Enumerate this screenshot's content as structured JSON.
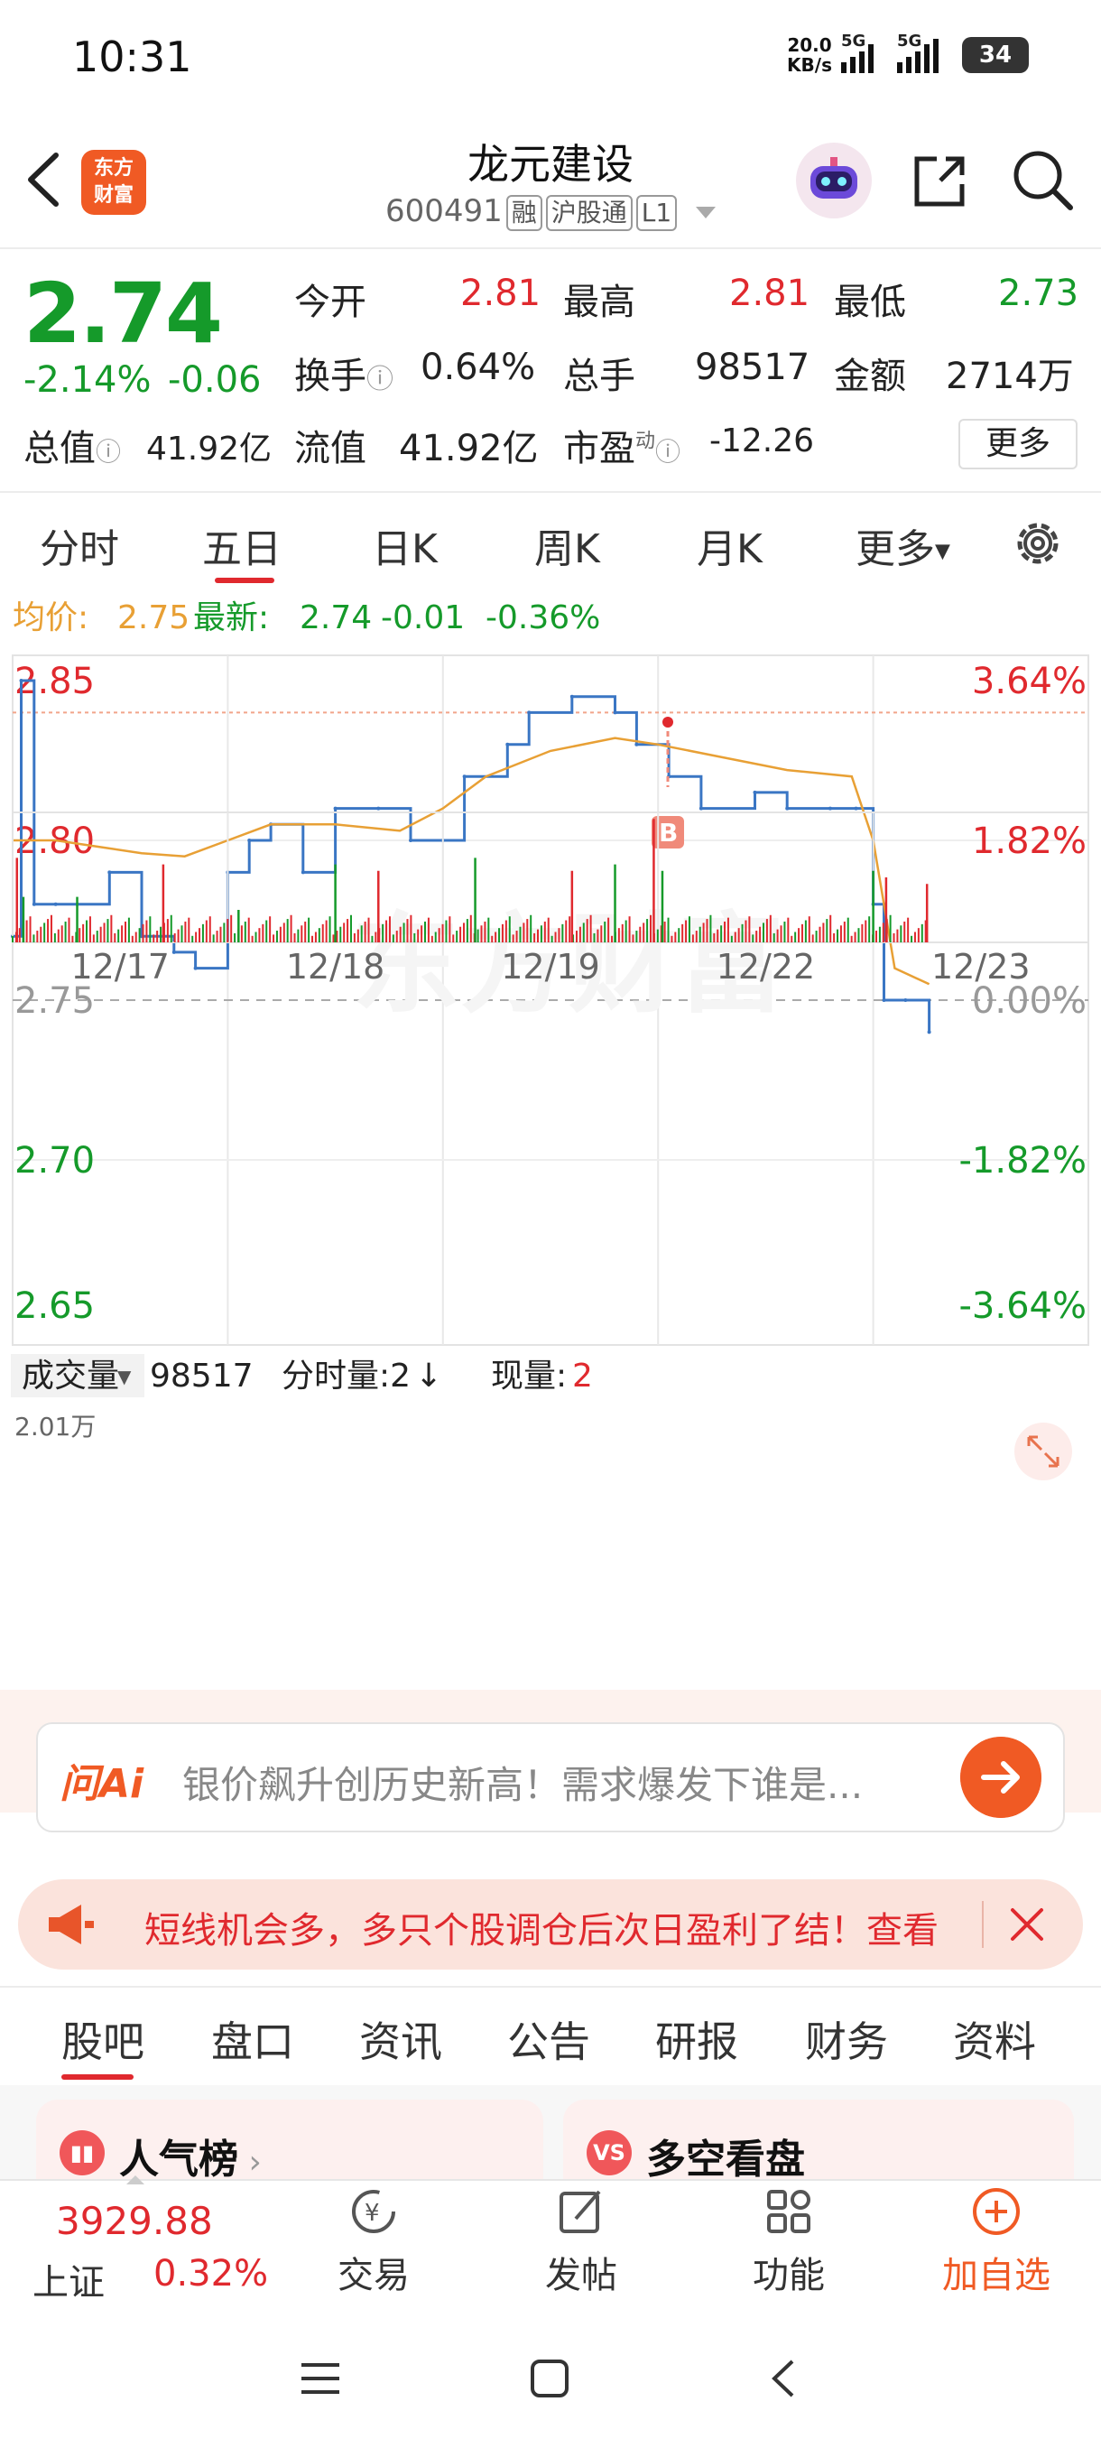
{
  "status_bar": {
    "time": "10:31",
    "net_speed_value": "20.0",
    "net_speed_unit": "KB/s",
    "signal1_label": "5G",
    "signal2_label": "5G",
    "battery": "34"
  },
  "header": {
    "logo_line1": "东方",
    "logo_line2": "财富",
    "stock_name": "龙元建设",
    "stock_code": "600491",
    "tag_rong": "融",
    "tag_hgt": "沪股通",
    "tag_level": "L1"
  },
  "quote": {
    "price": "2.74",
    "change_pct": "-2.14%",
    "change": "-0.06",
    "open_label": "今开",
    "open": "2.81",
    "high_label": "最高",
    "high": "2.81",
    "low_label": "最低",
    "low": "2.73",
    "turnover_label": "换手",
    "turnover": "0.64%",
    "volume_label": "总手",
    "volume": "98517",
    "amount_label": "金额",
    "amount": "2714万",
    "total_mv_label": "总值",
    "total_mv": "41.92亿",
    "float_mv_label": "流值",
    "float_mv": "41.92亿",
    "pe_label": "市盈",
    "pe_sup": "动",
    "pe": "-12.26",
    "more_label": "更多"
  },
  "period_tabs": [
    "分时",
    "五日",
    "日K",
    "周K",
    "月K",
    "更多"
  ],
  "period_tab_active": "五日",
  "chart_legend": {
    "avg_label": "均价:",
    "avg_value": "2.75",
    "latest_label": "最新:",
    "latest_value": "2.74",
    "latest_change": "-0.01",
    "latest_pct": "-0.36%"
  },
  "volume_bar": {
    "label": "成交量",
    "value": "98517",
    "minute_vol_label": "分时量:2",
    "current_label": "现量:",
    "current_value": "2",
    "max_label": "2.01万"
  },
  "chart_data": {
    "type": "line",
    "title": "",
    "x_days": [
      "12/17",
      "12/18",
      "12/19",
      "12/22",
      "12/23"
    ],
    "y_ticks": [
      "2.85",
      "2.80",
      "2.75",
      "2.70",
      "2.65"
    ],
    "y_pct_ticks": [
      "3.64%",
      "1.82%",
      "0.00%",
      "-1.82%",
      "-3.64%"
    ],
    "ylim": [
      2.65,
      2.85
    ],
    "prev_close": 2.75,
    "buy_marker": "B",
    "series": [
      {
        "name": "最新",
        "color": "#3a76c4",
        "points": [
          [
            0,
            2.77
          ],
          [
            0.04,
            2.85
          ],
          [
            0.1,
            2.78
          ],
          [
            0.2,
            2.78
          ],
          [
            0.3,
            2.78
          ],
          [
            0.45,
            2.79
          ],
          [
            0.6,
            2.77
          ],
          [
            0.75,
            2.765
          ],
          [
            0.85,
            2.76
          ],
          [
            1.0,
            2.79
          ],
          [
            1.1,
            2.8
          ],
          [
            1.2,
            2.805
          ],
          [
            1.35,
            2.79
          ],
          [
            1.5,
            2.81
          ],
          [
            1.7,
            2.81
          ],
          [
            1.85,
            2.8
          ],
          [
            2.0,
            2.8
          ],
          [
            2.1,
            2.82
          ],
          [
            2.3,
            2.83
          ],
          [
            2.4,
            2.84
          ],
          [
            2.6,
            2.845
          ],
          [
            2.8,
            2.84
          ],
          [
            2.9,
            2.83
          ],
          [
            3.05,
            2.82
          ],
          [
            3.2,
            2.81
          ],
          [
            3.45,
            2.815
          ],
          [
            3.6,
            2.81
          ],
          [
            3.8,
            2.81
          ],
          [
            3.92,
            2.81
          ],
          [
            4.0,
            2.78
          ],
          [
            4.05,
            2.75
          ],
          [
            4.15,
            2.75
          ],
          [
            4.26,
            2.74
          ]
        ]
      },
      {
        "name": "均价",
        "color": "#e8a035",
        "points": [
          [
            0,
            2.8
          ],
          [
            0.2,
            2.8
          ],
          [
            0.4,
            2.798
          ],
          [
            0.6,
            2.796
          ],
          [
            0.8,
            2.795
          ],
          [
            1.0,
            2.8
          ],
          [
            1.2,
            2.805
          ],
          [
            1.5,
            2.805
          ],
          [
            1.8,
            2.803
          ],
          [
            2.0,
            2.81
          ],
          [
            2.2,
            2.82
          ],
          [
            2.5,
            2.828
          ],
          [
            2.8,
            2.832
          ],
          [
            3.0,
            2.83
          ],
          [
            3.3,
            2.826
          ],
          [
            3.6,
            2.822
          ],
          [
            3.9,
            2.82
          ],
          [
            4.0,
            2.8
          ],
          [
            4.1,
            2.76
          ],
          [
            4.26,
            2.755
          ]
        ]
      }
    ]
  },
  "ai_bar": {
    "logo": "问Ai",
    "text": "银价飙升创历史新高！需求爆发下谁是..."
  },
  "notice": {
    "text": "短线机会多，多只个股调仓后次日盈利了结！查看"
  },
  "sub_tabs": [
    "股吧",
    "盘口",
    "资讯",
    "公告",
    "研报",
    "财务",
    "资料"
  ],
  "sub_tab_active": "股吧",
  "cards": [
    {
      "title": "人气榜",
      "icon": "chart-icon"
    },
    {
      "title": "多空看盘",
      "icon": "vs-icon"
    }
  ],
  "bottom_nav": {
    "index_value": "3929.88",
    "index_name": "上证",
    "index_pct": "0.32%",
    "items": [
      "交易",
      "发帖",
      "功能",
      "加自选"
    ]
  }
}
